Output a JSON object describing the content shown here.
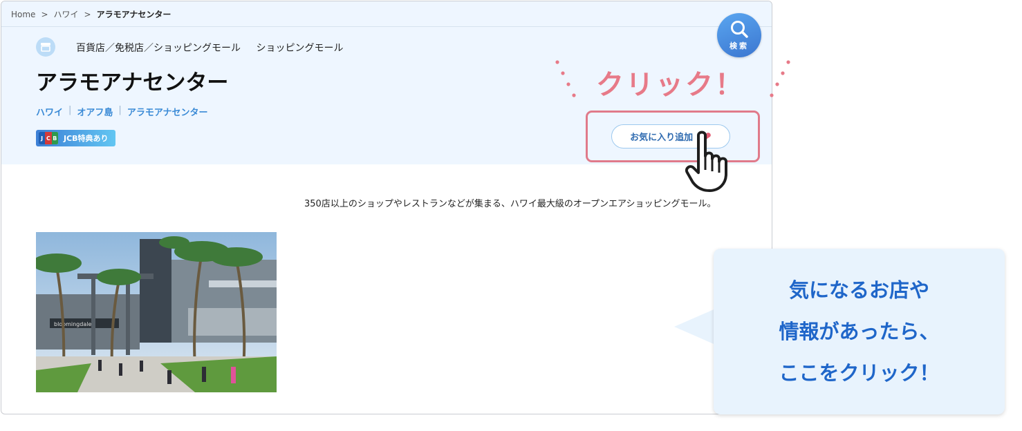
{
  "breadcrumb": {
    "items": [
      "Home",
      "ハワイ",
      "アラモアナセンター"
    ],
    "separator": ">"
  },
  "category": {
    "primary": "百貨店／免税店／ショッピングモール",
    "secondary": "ショッピングモール",
    "icon": "store-icon"
  },
  "page_title": "アラモアナセンター",
  "location": {
    "parts": [
      "ハワイ",
      "オアフ島",
      "アラモアナセンター"
    ],
    "separator": "|"
  },
  "badge": {
    "logo_text": "JCB",
    "label": "JCB特典あり"
  },
  "search": {
    "label": "検索",
    "icon": "search-icon"
  },
  "favorite": {
    "label": "お気に入り追加",
    "icon": "heart-icon"
  },
  "description": "350店以上のショップやレストランなどが集まる、ハワイ最大級のオープンエアショッピングモール。",
  "photo": {
    "store_sign": "bloomingdales",
    "icon": "mall-photo"
  },
  "annotation": {
    "click_label": "クリック！",
    "callout_lines": [
      "気になるお店や",
      "情報があったら、",
      "ここをクリック！"
    ]
  },
  "colors": {
    "accent_blue": "#3b76d0",
    "annotation_pink": "#e77a88",
    "callout_text": "#1f66c9",
    "hero_bg": "#eef6ff"
  }
}
